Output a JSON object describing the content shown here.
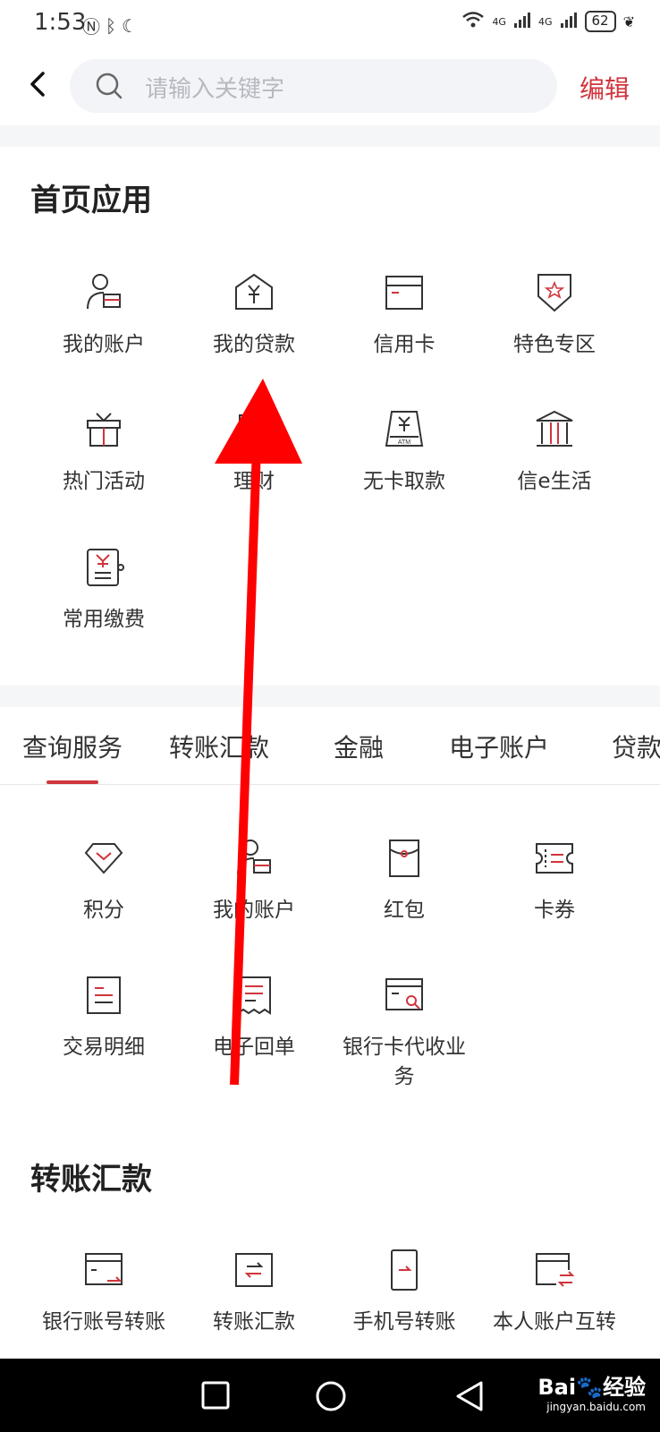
{
  "status": {
    "time": "1:53",
    "battery": "62",
    "net1": "4G",
    "net2": "4G"
  },
  "header": {
    "search_placeholder": "请输入关键字",
    "edit_label": "编辑"
  },
  "home_apps": {
    "title": "首页应用",
    "items": [
      {
        "label": "我的账户",
        "icon": "person-account-icon"
      },
      {
        "label": "我的贷款",
        "icon": "house-yen-icon"
      },
      {
        "label": "信用卡",
        "icon": "credit-card-icon"
      },
      {
        "label": "特色专区",
        "icon": "star-shield-icon"
      },
      {
        "label": "热门活动",
        "icon": "gift-icon"
      },
      {
        "label": "理财",
        "icon": "wealth-icon"
      },
      {
        "label": "无卡取款",
        "icon": "atm-icon"
      },
      {
        "label": "信e生活",
        "icon": "bank-building-icon"
      },
      {
        "label": "常用缴费",
        "icon": "bill-yen-icon"
      }
    ]
  },
  "tabs": [
    "查询服务",
    "转账汇款",
    "金融",
    "电子账户",
    "贷款"
  ],
  "query_services": {
    "items": [
      {
        "label": "积分",
        "icon": "diamond-icon"
      },
      {
        "label": "我的账户",
        "icon": "person-account-icon"
      },
      {
        "label": "红包",
        "icon": "red-envelope-icon"
      },
      {
        "label": "卡券",
        "icon": "coupon-icon"
      },
      {
        "label": "交易明细",
        "icon": "document-icon"
      },
      {
        "label": "电子回单",
        "icon": "receipt-icon"
      },
      {
        "label": "银行卡代收业务",
        "icon": "card-search-icon"
      }
    ]
  },
  "transfer": {
    "title": "转账汇款",
    "items": [
      {
        "label": "银行账号转账",
        "icon": "card-transfer-icon"
      },
      {
        "label": "转账汇款",
        "icon": "transfer-icon"
      },
      {
        "label": "手机号转账",
        "icon": "phone-transfer-icon"
      },
      {
        "label": "本人账户互转",
        "icon": "account-swap-icon"
      }
    ]
  },
  "watermark": {
    "brand": "Bai🐾经验",
    "url": "jingyan.baidu.com"
  },
  "colors": {
    "accent": "#d0353c",
    "icon_stroke": "#333",
    "arrow": "#ff0000"
  }
}
